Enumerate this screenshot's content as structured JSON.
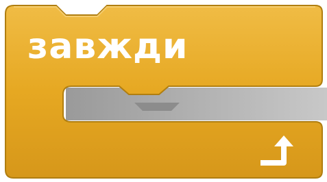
{
  "block": {
    "label": "завжди",
    "category": "control",
    "shape": "c-block-loop",
    "icon": "loop-arrow-icon"
  },
  "colors": {
    "fill": "#E6A822",
    "highlight": "#F3C55C",
    "shadow": "#B07E10",
    "notch_shade": "#7A7A7A",
    "text": "#FFFFFF"
  }
}
